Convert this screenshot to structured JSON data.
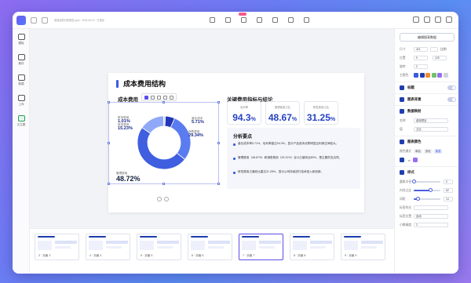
{
  "topbar": {
    "breadcrumb": "费用结构分析报告.pptx · 2023-03-12 · 已保存"
  },
  "leftbar": {
    "items": [
      {
        "label": "模板",
        "icon": "template-icon"
      },
      {
        "label": "素材",
        "icon": "assets-icon"
      },
      {
        "label": "数据",
        "icon": "data-icon"
      },
      {
        "label": "上传",
        "icon": "upload-icon"
      },
      {
        "label": "文生图",
        "icon": "text-to-image-icon"
      }
    ]
  },
  "slide": {
    "title": "成本费用结构",
    "left_panel_title": "成本费用",
    "right_panel_title": "关键费用指标与结论",
    "stats": [
      {
        "label": "毛利率",
        "value": "94.3",
        "unit": "%"
      },
      {
        "label": "管理费用占比",
        "value": "48.67",
        "unit": "%"
      },
      {
        "label": "研发费用占比",
        "value": "31.25",
        "unit": "%"
      }
    ],
    "key_points": {
      "heading": "分析要点",
      "items": [
        "营业成本率5.71%，毛利率高达94.3%，显示产品成本优势明显且利润空间较大。",
        "管理费用（48.67%）和销售费用（29.31%）合计占营收近80%，是主要的支出项。",
        "研发费用占营收比重达31.25%，显示公司持续进行技术投入和创新。"
      ]
    }
  },
  "chart_data": {
    "type": "pie",
    "categories": [
      "管理费用",
      "销售费用",
      "营业成本",
      "研发费用",
      "财务费用"
    ],
    "values": [
      48.72,
      29.34,
      5.71,
      15.23,
      1.01
    ],
    "labels": [
      "48.72%",
      "29.34%",
      "5.71%",
      "15.23%",
      "1.01%"
    ],
    "colors": [
      "#3f5fe0",
      "#5a7cf0",
      "#2336b8",
      "#8fa8f8",
      "#c5d3fb"
    ],
    "donut": true,
    "legend": "none"
  },
  "thumbs": [
    {
      "label": "3  · 页面 3"
    },
    {
      "label": "4  · 页面 4"
    },
    {
      "label": "5  · 页面 5"
    },
    {
      "label": "6  · 页面 6"
    },
    {
      "label": "7  · 页面 7"
    },
    {
      "label": "8  · 页面 8"
    },
    {
      "label": "9  · 页面 9"
    }
  ],
  "rpanel": {
    "edit_button": "编辑图表数据",
    "size_label": "尺寸",
    "width": "421",
    "lock_label": "比例",
    "pos_label": "位置",
    "x": "9",
    "y": "129",
    "rotate_label": "旋转",
    "rotate": "0",
    "theme_label": "主题色",
    "theme_colors": [
      "#3b5bdb",
      "#1f3fb0",
      "#f08c2e",
      "#6dc26b",
      "#9a6ef0",
      "#cfd3de"
    ],
    "sec_title": "标题",
    "sec_bg": "图表背景",
    "sec_mapping": "数据映射",
    "mapping_name_label": "名称",
    "mapping_name": "费用项目",
    "mapping_value_label": "值",
    "mapping_value": "占比",
    "sec_colors": "图表颜色",
    "color_mode_label": "颜色模式",
    "color_modes": [
      "单色",
      "多色",
      "渐变"
    ],
    "sec_style": "样式",
    "radius_label": "圆角半径",
    "radius": "0",
    "inner_label": "内径占比",
    "inner": "62",
    "gap_label": "间距",
    "gap": "14",
    "label_style_label": "标签样式",
    "label_pos_label": "标签位置",
    "label_pos": "自动",
    "decimals_label": "小数精度",
    "decimals": "2"
  }
}
